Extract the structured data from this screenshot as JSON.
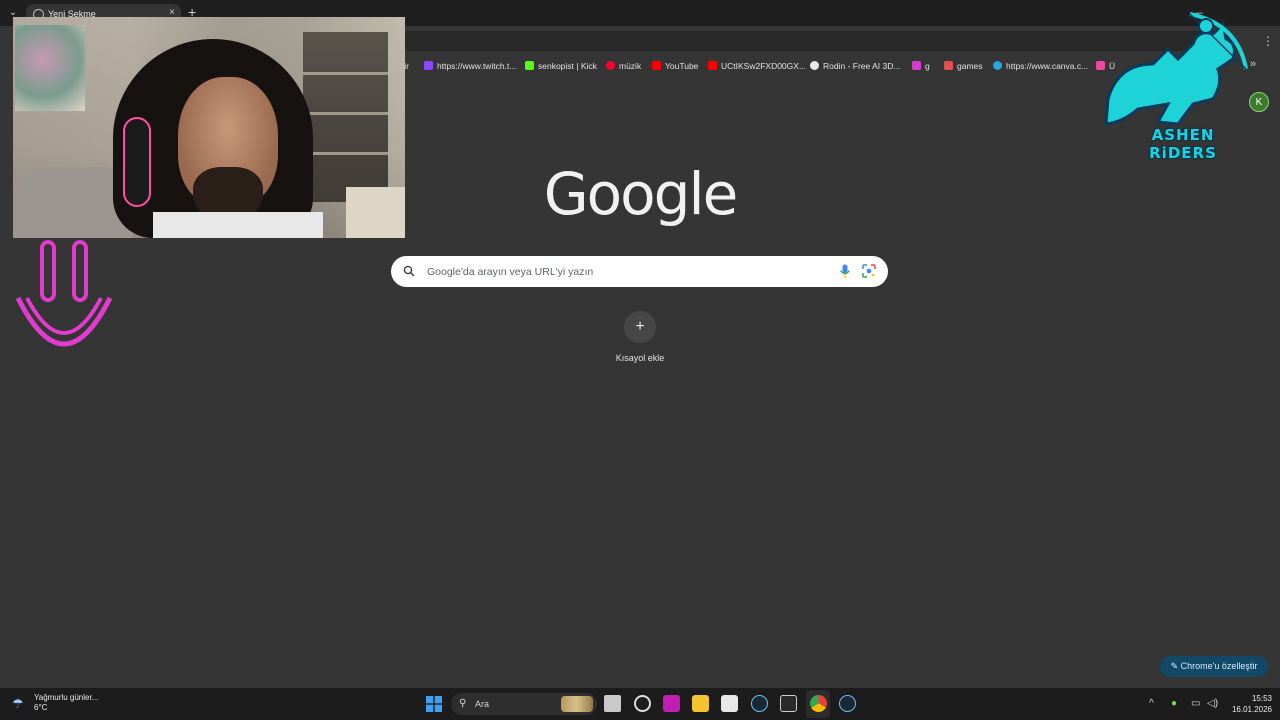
{
  "tab": {
    "title": "Yeni Sekme",
    "close": "×",
    "new_tab": "+"
  },
  "window": {
    "minimize": "–",
    "menu_dots": "⋮"
  },
  "bookmarks": [
    {
      "label": "vir",
      "color": "#353535"
    },
    {
      "label": "https://www.twitch.t...",
      "color": "#9146ff"
    },
    {
      "label": "senkopist | Kick",
      "color": "#53fc18"
    },
    {
      "label": "müzik",
      "color": "#ff0033"
    },
    {
      "label": "YouTube",
      "color": "#ff0000"
    },
    {
      "label": "UCtIKSw2FXD00GX...",
      "color": "#ff0000"
    },
    {
      "label": "Rodin - Free AI 3D...",
      "color": "#e8e8e8"
    },
    {
      "label": "g",
      "color": "#d63cd0"
    },
    {
      "label": "games",
      "color": "#e25050"
    },
    {
      "label": "https://www.canva.c...",
      "color": "#28a8e0"
    },
    {
      "label": "Ü",
      "color": "#ec4aa0"
    }
  ],
  "bookmarks_more": "»",
  "overlay": {
    "logo_text": "ASHEN RiDERS",
    "logo_color": "#19d3e0"
  },
  "profile": {
    "initial": "K"
  },
  "google": {
    "logo": "Google",
    "search_placeholder": "Google'da arayın veya URL'yi yazın",
    "shortcut_plus": "+",
    "shortcut_label": "Kısayol ekle",
    "customize_label": "Chrome'u özelleştir",
    "customize_icon": "pencil-icon"
  },
  "taskbar": {
    "weather_line1": "Yağmurlu günler...",
    "weather_line2": "6°C",
    "search_label": "Ara",
    "apps": [
      "file-explorer-app-icon",
      "snipping-app-icon",
      "streaming-app-icon",
      "folder-app-icon",
      "store-app-icon",
      "steam-app-icon",
      "epic-games-app-icon",
      "chrome-app-icon",
      "steam-secondary-app-icon"
    ],
    "tray_chevron": "^",
    "time": "15:53",
    "date": "16.01.2026"
  }
}
